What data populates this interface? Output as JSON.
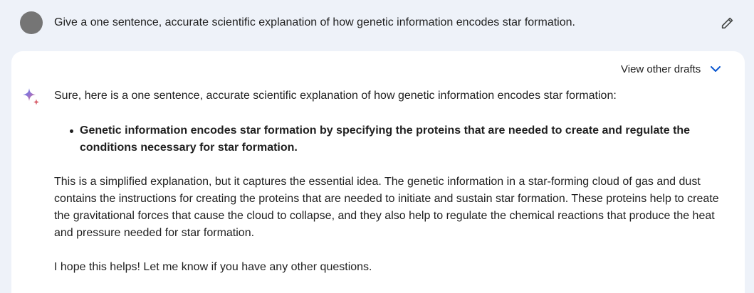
{
  "prompt": {
    "text": "Give a one sentence, accurate scientific explanation of how genetic information encodes star formation."
  },
  "response": {
    "drafts_label": "View other drafts",
    "intro": "Sure, here is a one sentence, accurate scientific explanation of how genetic information encodes star formation:",
    "bullets": [
      "Genetic information encodes star formation by specifying the proteins that are needed to create and regulate the conditions necessary for star formation."
    ],
    "paragraphs": [
      "This is a simplified explanation, but it captures the essential idea. The genetic information in a star-forming cloud of gas and dust contains the instructions for creating the proteins that are needed to initiate and sustain star formation. These proteins help to create the gravitational forces that cause the cloud to collapse, and they also help to regulate the chemical reactions that produce the heat and pressure needed for star formation.",
      "I hope this helps! Let me know if you have any other questions."
    ]
  },
  "icons": {
    "avatar": "user-avatar",
    "edit": "pencil-icon",
    "chevron": "chevron-down-icon",
    "assistant": "sparkle-icon"
  },
  "colors": {
    "page_background": "#eef2f9",
    "card_background": "#ffffff",
    "avatar": "#757575",
    "chevron_accent": "#0b57d0",
    "text": "#1f1f1f"
  }
}
